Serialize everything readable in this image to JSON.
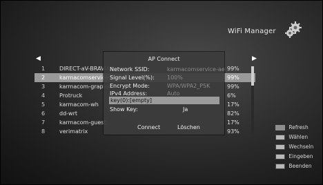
{
  "header": {
    "title": "WiFi Manager",
    "icon": "gear-icon"
  },
  "nav": {
    "left_arrow": "◀",
    "right_arrow": "▶"
  },
  "networks": [
    {
      "num": "1",
      "ssid": "DIRECT-aV-BRAVIA",
      "signal": "99%"
    },
    {
      "num": "2",
      "ssid": "karmacomservice-a",
      "signal": "99%",
      "selected": true
    },
    {
      "num": "3",
      "ssid": "karmacom-graphic",
      "signal": "99%"
    },
    {
      "num": "4",
      "ssid": "Protruck",
      "signal": "6%"
    },
    {
      "num": "5",
      "ssid": "karmacom-wh",
      "signal": "17%"
    },
    {
      "num": "6",
      "ssid": "dd-wrt",
      "signal": "82%"
    },
    {
      "num": "7",
      "ssid": "karmacom-guest",
      "signal": "17%"
    },
    {
      "num": "8",
      "ssid": "verimatrix",
      "signal": "93%"
    }
  ],
  "dialog": {
    "title": "AP Connect",
    "rows": [
      {
        "label": "Network SSID:",
        "value": "karmacomservice-ae"
      },
      {
        "label": "Signal Level(%):",
        "value": "100%"
      },
      {
        "label": "Encrypt Mode:",
        "value": "WPA/WPA2_PSK"
      },
      {
        "label": "IPv4 Address:",
        "value": "Auto"
      }
    ],
    "key_field": "key(0):[empty]",
    "show_key_label": "Show Key:",
    "show_key_value": "Ja",
    "connect_label": "Connect",
    "loschen_label": "Löschen"
  },
  "legend": [
    {
      "key": "red",
      "label": "Refresh"
    },
    {
      "key": "gray",
      "label": "Wählen"
    },
    {
      "key": "gray",
      "label": "Wechseln"
    },
    {
      "key": "gray",
      "label": "Eingeben"
    },
    {
      "key": "gray",
      "label": "Beenden"
    }
  ],
  "colors": {
    "selected_row": "#9a9a9a",
    "dialog_bg": "#3c3c3c"
  }
}
